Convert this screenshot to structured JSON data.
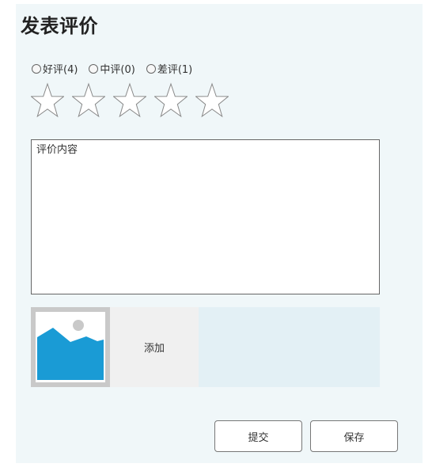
{
  "page": {
    "title": "发表评价"
  },
  "rating": {
    "options": [
      {
        "label": "好评(4)"
      },
      {
        "label": "中评(0)"
      },
      {
        "label": "差评(1)"
      }
    ],
    "stars_selected": 0,
    "stars_total": 5
  },
  "review": {
    "placeholder": "评价内容",
    "value": ""
  },
  "upload": {
    "thumbnail_icon": "image-placeholder-icon",
    "add_label": "添加"
  },
  "actions": {
    "submit_label": "提交",
    "save_label": "保存"
  },
  "colors": {
    "panel_bg": "#f0f7f9",
    "upload_bg": "#e3f0f5",
    "image_accent": "#1a9bd5",
    "border": "#666666"
  }
}
